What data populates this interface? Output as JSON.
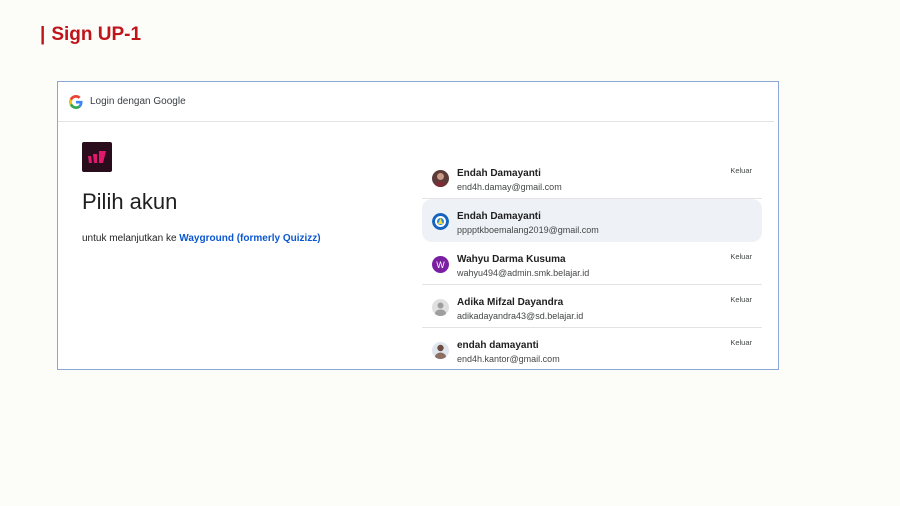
{
  "slide": {
    "title": "Sign UP-1",
    "bar": "|"
  },
  "google_bar": {
    "label": "Login dengan Google"
  },
  "main": {
    "heading": "Pilih akun",
    "sub_prefix": "untuk melanjutkan ke",
    "app_name": "Wayground (formerly Quizizz)"
  },
  "accounts": [
    {
      "name": "Endah Damayanti",
      "email": "end4h.damay@gmail.com",
      "action": "Keluar",
      "avatar": "photo-avatar"
    },
    {
      "name": "Endah Damayanti",
      "email": "pppptkboemalang2019@gmail.com",
      "action": "",
      "avatar": "org-logo-avatar"
    },
    {
      "name": "Wahyu Darma Kusuma",
      "email": "wahyu494@admin.smk.belajar.id",
      "action": "Keluar",
      "avatar": "letter-avatar",
      "initial": "W"
    },
    {
      "name": "Adika Mifzal Dayandra",
      "email": "adikadayandra43@sd.belajar.id",
      "action": "Keluar",
      "avatar": "default-person-avatar"
    },
    {
      "name": "endah damayanti",
      "email": "end4h.kantor@gmail.com",
      "action": "Keluar",
      "avatar": "photo-avatar"
    }
  ],
  "colors": {
    "slide_title": "#c0141b",
    "link": "#0b57d0",
    "selected_row": "#eef2f7",
    "letter_avatar": "#7b1fa2",
    "app_logo_bg": "#2a0d1c",
    "app_logo_fg": "#e2186f"
  }
}
